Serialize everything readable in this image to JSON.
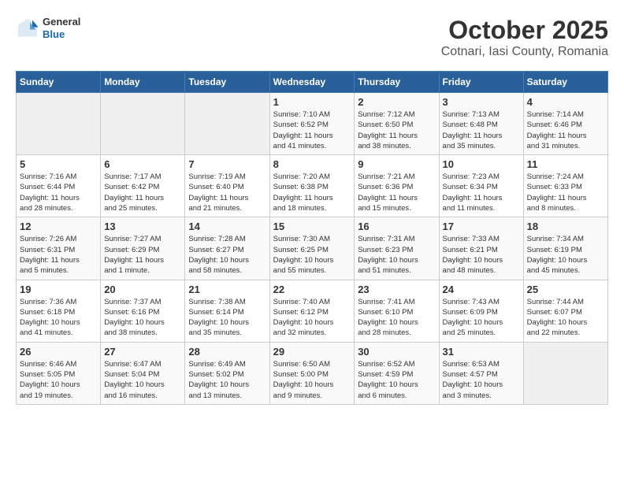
{
  "logo": {
    "general": "General",
    "blue": "Blue"
  },
  "title": "October 2025",
  "subtitle": "Cotnari, Iasi County, Romania",
  "days_header": [
    "Sunday",
    "Monday",
    "Tuesday",
    "Wednesday",
    "Thursday",
    "Friday",
    "Saturday"
  ],
  "weeks": [
    [
      {
        "num": "",
        "info": ""
      },
      {
        "num": "",
        "info": ""
      },
      {
        "num": "",
        "info": ""
      },
      {
        "num": "1",
        "info": "Sunrise: 7:10 AM\nSunset: 6:52 PM\nDaylight: 11 hours\nand 41 minutes."
      },
      {
        "num": "2",
        "info": "Sunrise: 7:12 AM\nSunset: 6:50 PM\nDaylight: 11 hours\nand 38 minutes."
      },
      {
        "num": "3",
        "info": "Sunrise: 7:13 AM\nSunset: 6:48 PM\nDaylight: 11 hours\nand 35 minutes."
      },
      {
        "num": "4",
        "info": "Sunrise: 7:14 AM\nSunset: 6:46 PM\nDaylight: 11 hours\nand 31 minutes."
      }
    ],
    [
      {
        "num": "5",
        "info": "Sunrise: 7:16 AM\nSunset: 6:44 PM\nDaylight: 11 hours\nand 28 minutes."
      },
      {
        "num": "6",
        "info": "Sunrise: 7:17 AM\nSunset: 6:42 PM\nDaylight: 11 hours\nand 25 minutes."
      },
      {
        "num": "7",
        "info": "Sunrise: 7:19 AM\nSunset: 6:40 PM\nDaylight: 11 hours\nand 21 minutes."
      },
      {
        "num": "8",
        "info": "Sunrise: 7:20 AM\nSunset: 6:38 PM\nDaylight: 11 hours\nand 18 minutes."
      },
      {
        "num": "9",
        "info": "Sunrise: 7:21 AM\nSunset: 6:36 PM\nDaylight: 11 hours\nand 15 minutes."
      },
      {
        "num": "10",
        "info": "Sunrise: 7:23 AM\nSunset: 6:34 PM\nDaylight: 11 hours\nand 11 minutes."
      },
      {
        "num": "11",
        "info": "Sunrise: 7:24 AM\nSunset: 6:33 PM\nDaylight: 11 hours\nand 8 minutes."
      }
    ],
    [
      {
        "num": "12",
        "info": "Sunrise: 7:26 AM\nSunset: 6:31 PM\nDaylight: 11 hours\nand 5 minutes."
      },
      {
        "num": "13",
        "info": "Sunrise: 7:27 AM\nSunset: 6:29 PM\nDaylight: 11 hours\nand 1 minute."
      },
      {
        "num": "14",
        "info": "Sunrise: 7:28 AM\nSunset: 6:27 PM\nDaylight: 10 hours\nand 58 minutes."
      },
      {
        "num": "15",
        "info": "Sunrise: 7:30 AM\nSunset: 6:25 PM\nDaylight: 10 hours\nand 55 minutes."
      },
      {
        "num": "16",
        "info": "Sunrise: 7:31 AM\nSunset: 6:23 PM\nDaylight: 10 hours\nand 51 minutes."
      },
      {
        "num": "17",
        "info": "Sunrise: 7:33 AM\nSunset: 6:21 PM\nDaylight: 10 hours\nand 48 minutes."
      },
      {
        "num": "18",
        "info": "Sunrise: 7:34 AM\nSunset: 6:19 PM\nDaylight: 10 hours\nand 45 minutes."
      }
    ],
    [
      {
        "num": "19",
        "info": "Sunrise: 7:36 AM\nSunset: 6:18 PM\nDaylight: 10 hours\nand 41 minutes."
      },
      {
        "num": "20",
        "info": "Sunrise: 7:37 AM\nSunset: 6:16 PM\nDaylight: 10 hours\nand 38 minutes."
      },
      {
        "num": "21",
        "info": "Sunrise: 7:38 AM\nSunset: 6:14 PM\nDaylight: 10 hours\nand 35 minutes."
      },
      {
        "num": "22",
        "info": "Sunrise: 7:40 AM\nSunset: 6:12 PM\nDaylight: 10 hours\nand 32 minutes."
      },
      {
        "num": "23",
        "info": "Sunrise: 7:41 AM\nSunset: 6:10 PM\nDaylight: 10 hours\nand 28 minutes."
      },
      {
        "num": "24",
        "info": "Sunrise: 7:43 AM\nSunset: 6:09 PM\nDaylight: 10 hours\nand 25 minutes."
      },
      {
        "num": "25",
        "info": "Sunrise: 7:44 AM\nSunset: 6:07 PM\nDaylight: 10 hours\nand 22 minutes."
      }
    ],
    [
      {
        "num": "26",
        "info": "Sunrise: 6:46 AM\nSunset: 5:05 PM\nDaylight: 10 hours\nand 19 minutes."
      },
      {
        "num": "27",
        "info": "Sunrise: 6:47 AM\nSunset: 5:04 PM\nDaylight: 10 hours\nand 16 minutes."
      },
      {
        "num": "28",
        "info": "Sunrise: 6:49 AM\nSunset: 5:02 PM\nDaylight: 10 hours\nand 13 minutes."
      },
      {
        "num": "29",
        "info": "Sunrise: 6:50 AM\nSunset: 5:00 PM\nDaylight: 10 hours\nand 9 minutes."
      },
      {
        "num": "30",
        "info": "Sunrise: 6:52 AM\nSunset: 4:59 PM\nDaylight: 10 hours\nand 6 minutes."
      },
      {
        "num": "31",
        "info": "Sunrise: 6:53 AM\nSunset: 4:57 PM\nDaylight: 10 hours\nand 3 minutes."
      },
      {
        "num": "",
        "info": ""
      }
    ]
  ]
}
